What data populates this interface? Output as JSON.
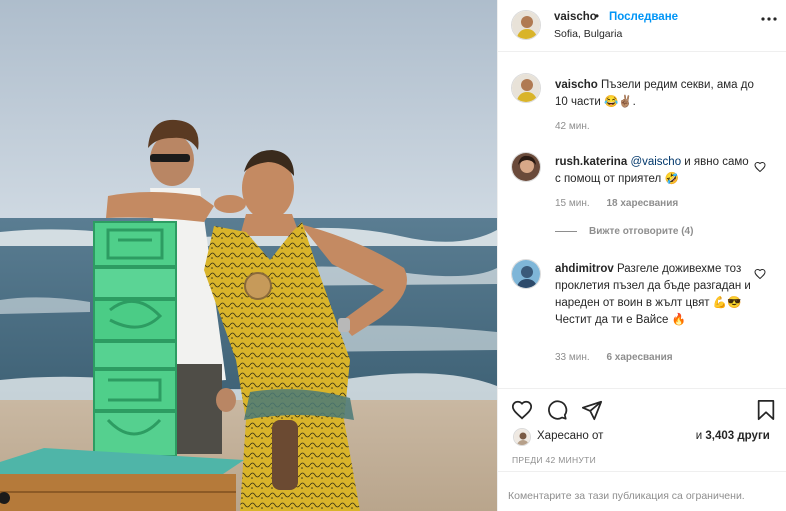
{
  "header": {
    "username": "vaischo",
    "separator": "•",
    "follow_label": "Последване",
    "location": "Sofia, Bulgaria",
    "more_icon": "more-horizontal-icon"
  },
  "caption": {
    "username": "vaischo",
    "text": "Пъзели редим секви, ама до 10 части 😂✌🏽.",
    "time": "42 мин."
  },
  "comments": [
    {
      "username": "rush.katerina",
      "mention": "@vaischo",
      "text": " и явно само с помощ от приятел 🤣",
      "time": "15 мин.",
      "likes": "18 харесвания"
    },
    {
      "username": "ahdimitrov",
      "text": "Разгеле доживехме тоз проклетия пъзел да бъде разгадан и нареден от воин в жълт цвят 💪😎 Честит да ти е Вайсе 🔥",
      "time": "33 мин.",
      "likes": "6 харесвания"
    }
  ],
  "view_replies": "Вижте отговорите (4)",
  "actions": {
    "like_icon": "heart-icon",
    "comment_icon": "comment-icon",
    "share_icon": "send-icon",
    "save_icon": "bookmark-icon"
  },
  "liked_by": {
    "prefix": "Харесано от",
    "conjunction": "и",
    "others": "3,403 други"
  },
  "timestamp": "ПРЕДИ 42 МИНУТИ",
  "comments_restricted": "Коментарите за тази публикация са ограничени.",
  "colors": {
    "accent": "#0095f6",
    "text": "#262626",
    "muted": "#8e8e8e",
    "border": "#efefef"
  }
}
